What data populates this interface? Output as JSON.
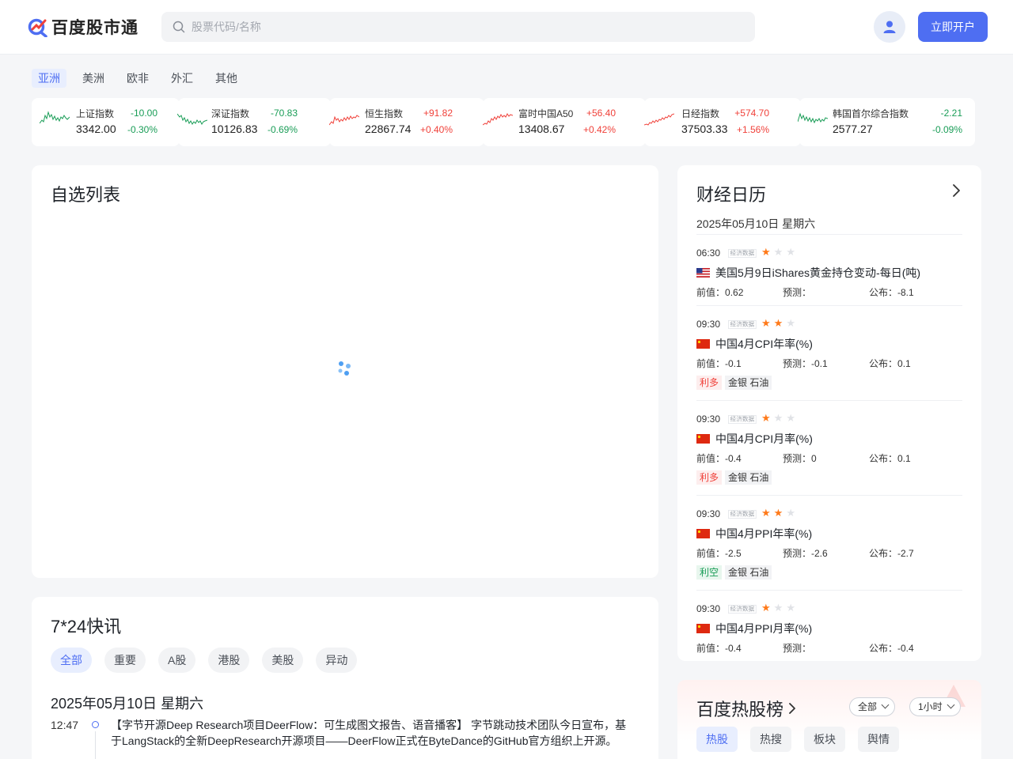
{
  "header": {
    "logo_text": "百度股市通",
    "search_placeholder": "股票代码/名称",
    "open_account_label": "立即开户",
    "avatar_icon": "user-icon"
  },
  "region_tabs": [
    "亚洲",
    "美洲",
    "欧非",
    "外汇",
    "其他"
  ],
  "region_active": "亚洲",
  "indices": [
    {
      "name": "上证指数",
      "price": "3342.00",
      "change": "-10.00",
      "pct": "-0.30%",
      "trend": "down"
    },
    {
      "name": "深证指数",
      "price": "10126.83",
      "change": "-70.83",
      "pct": "-0.69%",
      "trend": "down"
    },
    {
      "name": "恒生指数",
      "price": "22867.74",
      "change": "+91.82",
      "pct": "+0.40%",
      "trend": "up"
    },
    {
      "name": "富时中国A50",
      "price": "13408.67",
      "change": "+56.40",
      "pct": "+0.42%",
      "trend": "up"
    },
    {
      "name": "日经指数",
      "price": "37503.33",
      "change": "+574.70",
      "pct": "+1.56%",
      "trend": "up"
    },
    {
      "name": "韩国首尔综合指数",
      "price": "2577.27",
      "change": "-2.21",
      "pct": "-0.09%",
      "trend": "down"
    }
  ],
  "colors": {
    "up": "#f0413a",
    "down": "#1a9d57",
    "accent": "#4e6ef2"
  },
  "watchlist": {
    "title": "自选列表"
  },
  "news": {
    "title": "7*24快讯",
    "tabs": [
      "全部",
      "重要",
      "A股",
      "港股",
      "美股",
      "异动"
    ],
    "date": "2025年05月10日 星期六",
    "items": [
      {
        "time": "12:47",
        "text": "【字节开源Deep Research项目DeerFlow：可生成图文报告、语音播客】 字节跳动技术团队今日宣布，基于LangStack的全新DeepResearch开源项目——DeerFlow正式在ByteDance的GitHub官方组织上开源。"
      }
    ]
  },
  "calendar": {
    "title": "财经日历",
    "date": "2025年05月10日 星期六",
    "tag": "经济数据",
    "labels": {
      "prev": "前值：",
      "forecast": "预测：",
      "actual": "公布："
    },
    "events": [
      {
        "time": "06:30",
        "stars": 1,
        "flag": "us-flag",
        "title": "美国5月9日iShares黄金持仓变动-每日(吨)",
        "prev": "0.62",
        "forecast": "",
        "actual": "-8.1",
        "impact": "",
        "assets": ""
      },
      {
        "time": "09:30",
        "stars": 2,
        "flag": "cn-flag",
        "title": "中国4月CPI年率(%)",
        "prev": "-0.1",
        "forecast": "-0.1",
        "actual": "0.1",
        "impact": "利多",
        "assets": "金银 石油"
      },
      {
        "time": "09:30",
        "stars": 1,
        "flag": "cn-flag",
        "title": "中国4月CPI月率(%)",
        "prev": "-0.4",
        "forecast": "0",
        "actual": "0.1",
        "impact": "利多",
        "assets": "金银 石油"
      },
      {
        "time": "09:30",
        "stars": 2,
        "flag": "cn-flag",
        "title": "中国4月PPI年率(%)",
        "prev": "-2.5",
        "forecast": "-2.6",
        "actual": "-2.7",
        "impact": "利空",
        "assets": "金银 石油"
      },
      {
        "time": "09:30",
        "stars": 1,
        "flag": "cn-flag",
        "title": "中国4月PPI月率(%)",
        "prev": "-0.4",
        "forecast": "",
        "actual": "-0.4",
        "impact": "",
        "assets": ""
      }
    ]
  },
  "hot": {
    "title": "百度热股榜",
    "filter_market": "全部",
    "filter_period": "1小时",
    "tabs": [
      "热股",
      "热搜",
      "板块",
      "舆情"
    ]
  }
}
